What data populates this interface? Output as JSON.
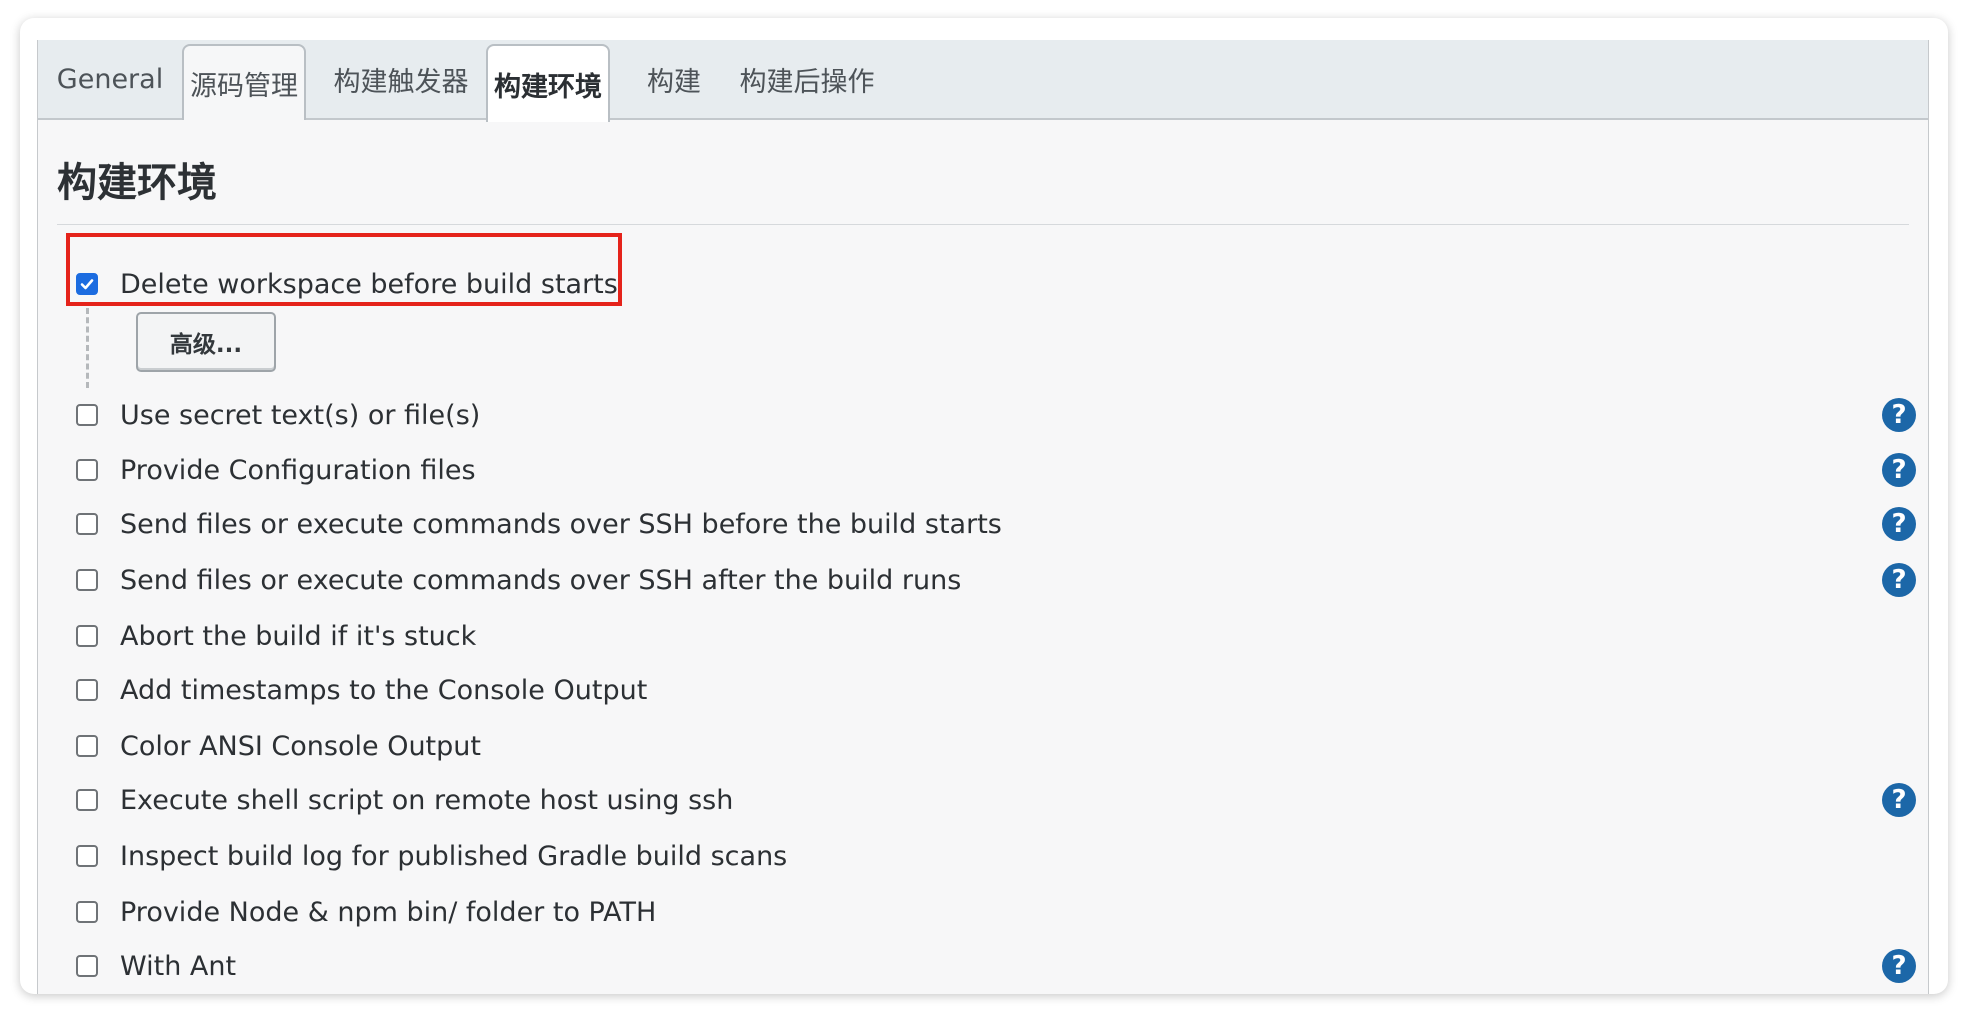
{
  "tabs": [
    {
      "label": "General"
    },
    {
      "label": "源码管理"
    },
    {
      "label": "构建触发器"
    },
    {
      "label": "构建环境"
    },
    {
      "label": "构建"
    },
    {
      "label": "构建后操作"
    }
  ],
  "active_tab": "构建环境",
  "section": {
    "title": "构建环境"
  },
  "advanced_button": {
    "label": "高级..."
  },
  "options": [
    {
      "label": "Delete workspace before build starts",
      "checked": true,
      "help": false,
      "highlighted": true
    },
    {
      "label": "Use secret text(s) or file(s)",
      "checked": false,
      "help": true
    },
    {
      "label": "Provide Configuration files",
      "checked": false,
      "help": true
    },
    {
      "label": "Send files or execute commands over SSH before the build starts",
      "checked": false,
      "help": true
    },
    {
      "label": "Send files or execute commands over SSH after the build runs",
      "checked": false,
      "help": true
    },
    {
      "label": "Abort the build if it's stuck",
      "checked": false,
      "help": false
    },
    {
      "label": "Add timestamps to the Console Output",
      "checked": false,
      "help": false
    },
    {
      "label": "Color ANSI Console Output",
      "checked": false,
      "help": false
    },
    {
      "label": "Execute shell script on remote host using ssh",
      "checked": false,
      "help": true
    },
    {
      "label": "Inspect build log for published Gradle build scans",
      "checked": false,
      "help": false
    },
    {
      "label": "Provide Node & npm bin/ folder to PATH",
      "checked": false,
      "help": false
    },
    {
      "label": "With Ant",
      "checked": false,
      "help": true
    }
  ],
  "help_icon": {
    "glyph": "?",
    "name": "help-icon",
    "color": "#1c67a8"
  },
  "colors": {
    "highlight": "#e5231b",
    "checkbox_checked": "#1c6ce0"
  }
}
